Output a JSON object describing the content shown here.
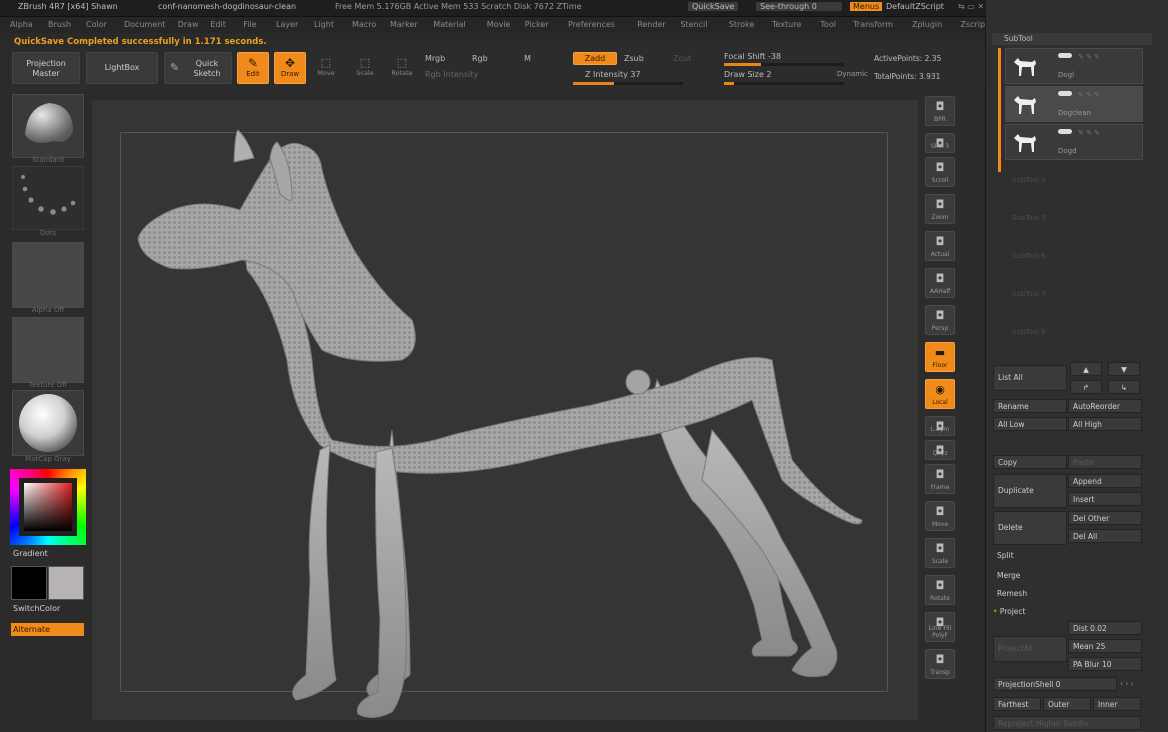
{
  "titlebar": {
    "app": "ZBrush 4R7 [x64] Shawn",
    "file": "conf-nanomesh-dogdinosaur-clean",
    "stats": "Free Mem 5.176GB  Active Mem 533  Scratch Disk 7672  ZTime",
    "quicksave": "QuickSave",
    "seethrough": "See-through",
    "seethrough_value": "0",
    "menus": "Menus",
    "defaultscript": "DefaultZScript"
  },
  "menubar": [
    "Alpha",
    "Brush",
    "Color",
    "Document",
    "Draw",
    "Edit",
    "File",
    "Layer",
    "Light",
    "Macro",
    "Marker",
    "Material",
    "Movie",
    "Picker",
    "Preferences",
    "Render",
    "Stencil",
    "Stroke",
    "Texture",
    "Tool",
    "Transform",
    "Zplugin",
    "Zscript"
  ],
  "status_message": "QuickSave Completed successfully in 1.171 seconds.",
  "toolbar": {
    "projection_master": "Projection Master",
    "lightbox": "LightBox",
    "quick_sketch": "Quick Sketch",
    "edit": "Edit",
    "draw": "Draw",
    "move": "Move",
    "scale": "Scale",
    "rotate": "Rotate",
    "mrgb": "Mrgb",
    "rgb": "Rgb",
    "m": "M",
    "rgb_intensity": "Rgb Intensity",
    "zadd": "Zadd",
    "zsub": "Zsub",
    "zcut": "Zcut",
    "z_intensity": "Z Intensity 37",
    "focal_shift": "Focal Shift -38",
    "draw_size": "Draw Size 2",
    "dynamic": "Dynamic",
    "active_points": "ActivePoints: 2.35",
    "total_points": "TotalPoints: 3.931"
  },
  "sliders": {
    "z_intensity": 0.37,
    "focal_shift": 0.31,
    "draw_size": 0.02
  },
  "leftpanel": {
    "brush_label": "Standard",
    "stroke_label": "Dots",
    "alpha_label": "Alpha Off",
    "texture_label": "Texture Off",
    "material_label": "MatCap Gray",
    "gradient": "Gradient",
    "switchcolor": "SwitchColor",
    "alternate": "Alternate"
  },
  "rightstrip": [
    {
      "label": "BPR",
      "icon": "bpr-icon"
    },
    {
      "label": "SPix 3",
      "icon": "spix-slider"
    },
    {
      "label": "Scroll",
      "icon": "scroll-icon"
    },
    {
      "label": "Zoom",
      "icon": "zoom-icon"
    },
    {
      "label": "Actual",
      "icon": "actual-icon"
    },
    {
      "label": "AAHalf",
      "icon": "aahalf-icon"
    },
    {
      "label": "Persp",
      "icon": "persp-icon"
    },
    {
      "label": "Floor",
      "icon": "floor-icon"
    },
    {
      "label": "Local",
      "icon": "local-icon"
    },
    {
      "label": "L.Sym",
      "icon": "lsym-icon"
    },
    {
      "label": "Qxyz",
      "icon": "qxyz-icon"
    },
    {
      "label": "Frame",
      "icon": "frame-icon"
    },
    {
      "label": "Move",
      "icon": "move-icon"
    },
    {
      "label": "Scale",
      "icon": "scale-icon"
    },
    {
      "label": "Rotate",
      "icon": "rotate-icon"
    },
    {
      "label": "Line Fill PolyF",
      "icon": "polyf-icon"
    },
    {
      "label": "Transp",
      "icon": "transp-icon"
    }
  ],
  "subtool": {
    "header": "SubTool",
    "items": [
      {
        "name": "Dogl"
      },
      {
        "name": "Dogclean"
      },
      {
        "name": "Dogd"
      }
    ],
    "ghost_slots": [
      "SubTool 4",
      "SubTool 5",
      "SubTool 6",
      "SubTool 7",
      "SubTool 8"
    ],
    "list_all": "List All",
    "rename": "Rename",
    "autoreorder": "AutoReorder",
    "all_low": "All Low",
    "all_high": "All High",
    "copy": "Copy",
    "paste": "Paste",
    "duplicate": "Duplicate",
    "append": "Append",
    "insert": "Insert",
    "delete": "Delete",
    "del_other": "Del Other",
    "del_all": "Del All",
    "split": "Split",
    "merge": "Merge",
    "remesh": "Remesh",
    "project": "Project",
    "project_all": "ProjectAll",
    "dist": "Dist 0.02",
    "mean": "Mean 25",
    "pa_blur": "PA Blur 10",
    "projection_shell": "ProjectionShell 0",
    "farthest": "Farthest",
    "outer": "Outer",
    "inner": "Inner",
    "reproject": "Reproject Higher Subdiv"
  },
  "colors": {
    "accent": "#f08a1a",
    "status": "#e8a020",
    "model": "#a8a8a8"
  }
}
